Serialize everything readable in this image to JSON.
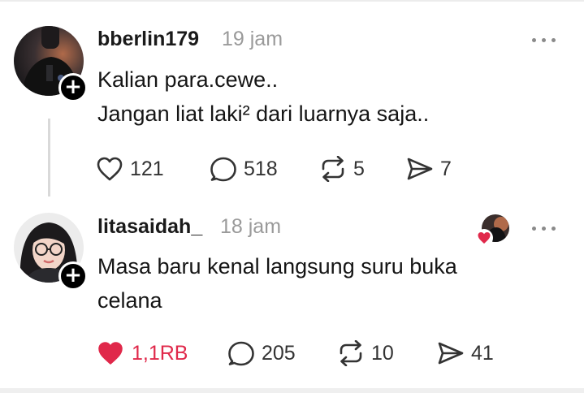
{
  "posts": [
    {
      "username": "bberlin179",
      "time": "19 jam",
      "lines": [
        "Kalian para.cewe..",
        "Jangan liat laki² dari luarnya saja.."
      ],
      "likes": "121",
      "comments": "518",
      "reposts": "5",
      "shares": "7",
      "liked": false
    },
    {
      "username": "litasaidah_",
      "time": "18 jam",
      "lines": [
        "Masa baru kenal langsung suru buka",
        "celana"
      ],
      "likes": "1,1RB",
      "comments": "205",
      "reposts": "10",
      "shares": "41",
      "liked": true
    }
  ],
  "colors": {
    "like_red": "#e0284a",
    "muted": "#9a9a9a",
    "icon": "#333333"
  },
  "icons": [
    "heart-icon",
    "comment-icon",
    "repost-icon",
    "share-icon",
    "more-icon",
    "follow-plus-icon"
  ]
}
